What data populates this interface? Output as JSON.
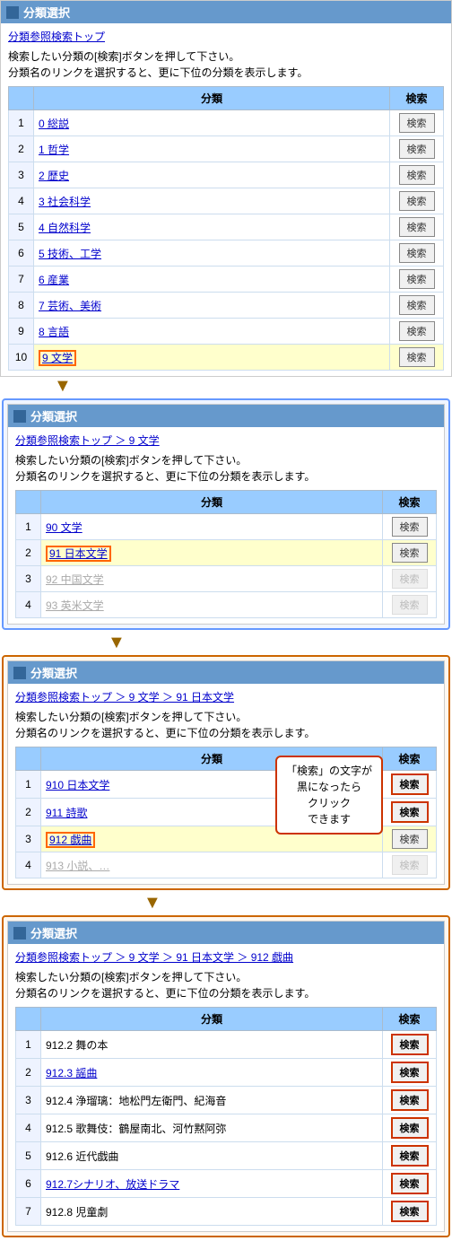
{
  "section1": {
    "title": "分類選択",
    "breadcrumb": "分類参照検索トップ",
    "desc1": "検索したい分類の[検索]ボタンを押して下さい。",
    "desc2": "分類名のリンクを選択すると、更に下位の分類を表示します。",
    "table": {
      "col1": "分類",
      "col2": "検索",
      "rows": [
        {
          "num": "1",
          "name": "0 総説",
          "link": true,
          "search": "検索",
          "highlight": false,
          "active": false
        },
        {
          "num": "2",
          "name": "1 哲学",
          "link": true,
          "search": "検索",
          "highlight": false,
          "active": false
        },
        {
          "num": "3",
          "name": "2 歴史",
          "link": true,
          "search": "検索",
          "highlight": false,
          "active": false
        },
        {
          "num": "4",
          "name": "3 社会科学",
          "link": true,
          "search": "検索",
          "highlight": false,
          "active": false
        },
        {
          "num": "5",
          "name": "4 自然科学",
          "link": true,
          "search": "検索",
          "highlight": false,
          "active": false
        },
        {
          "num": "6",
          "name": "5 技術、工学",
          "link": true,
          "search": "検索",
          "highlight": false,
          "active": false
        },
        {
          "num": "7",
          "name": "6 産業",
          "link": true,
          "search": "検索",
          "highlight": false,
          "active": false
        },
        {
          "num": "8",
          "name": "7 芸術、美術",
          "link": true,
          "search": "検索",
          "highlight": false,
          "active": false
        },
        {
          "num": "9",
          "name": "8 言語",
          "link": true,
          "search": "検索",
          "highlight": false,
          "active": false
        },
        {
          "num": "10",
          "name": "9 文学",
          "link": true,
          "search": "検索",
          "highlight": true,
          "active": false,
          "selected": true
        }
      ]
    }
  },
  "section2": {
    "title": "分類選択",
    "breadcrumb": "分類参照検索トップ ＞ 9 文学",
    "desc1": "検索したい分類の[検索]ボタンを押して下さい。",
    "desc2": "分類名のリンクを選択すると、更に下位の分類を表示します。",
    "table": {
      "col1": "分類",
      "col2": "検索",
      "rows": [
        {
          "num": "1",
          "name": "90 文学",
          "link": true,
          "search": "検索",
          "highlight": false,
          "active": false
        },
        {
          "num": "2",
          "name": "91 日本文学",
          "link": true,
          "search": "検索",
          "highlight": true,
          "active": false,
          "selected": true
        },
        {
          "num": "3",
          "name": "92 中国文学",
          "link": true,
          "search": "検索",
          "highlight": false,
          "active": false,
          "gray": true
        },
        {
          "num": "4",
          "name": "93 英米文学",
          "link": true,
          "search": "検索",
          "highlight": false,
          "active": false,
          "gray": true
        }
      ]
    }
  },
  "section3": {
    "title": "分類選択",
    "breadcrumb": "分類参照検索トップ ＞ 9 文学 ＞ 91 日本文学",
    "desc1": "検索したい分類の[検索]ボタンを押して下さい。",
    "desc2": "分類名のリンクを選択すると、更に下位の分類を表示します。",
    "tooltip": "「検索」の文字が\n黒になったら\nクリック\nできます",
    "table": {
      "col1": "分類",
      "col2": "検索",
      "rows": [
        {
          "num": "1",
          "name": "910 日本文学",
          "link": true,
          "search": "検索",
          "highlight": false,
          "active": true
        },
        {
          "num": "2",
          "name": "911 詩歌",
          "link": true,
          "search": "検索",
          "highlight": false,
          "active": true
        },
        {
          "num": "3",
          "name": "912 戯曲",
          "link": true,
          "search": "検索",
          "highlight": true,
          "active": false,
          "selected": true
        },
        {
          "num": "4",
          "name": "913 小説、…",
          "link": true,
          "search": "検索",
          "highlight": false,
          "active": false,
          "gray": true
        }
      ]
    }
  },
  "section4": {
    "title": "分類選択",
    "breadcrumb": "分類参照検索トップ ＞ 9 文学 ＞ 91 日本文学 ＞ 912 戯曲",
    "desc1": "検索したい分類の[検索]ボタンを押して下さい。",
    "desc2": "分類名のリンクを選択すると、更に下位の分類を表示します。",
    "table": {
      "col1": "分類",
      "col2": "検索",
      "rows": [
        {
          "num": "1",
          "name": "912.2 舞の本",
          "link": false,
          "search": "検索",
          "highlight": false,
          "active": true
        },
        {
          "num": "2",
          "name": "912.3 謡曲",
          "link": true,
          "search": "検索",
          "highlight": false,
          "active": true
        },
        {
          "num": "3",
          "name": "912.4 浄瑠璃：地松門左衛門、紀海音",
          "link": false,
          "search": "検索",
          "highlight": false,
          "active": true
        },
        {
          "num": "4",
          "name": "912.5 歌舞伎：鶴屋南北、河竹黙阿弥",
          "link": false,
          "search": "検索",
          "highlight": false,
          "active": true
        },
        {
          "num": "5",
          "name": "912.6 近代戯曲",
          "link": false,
          "search": "検索",
          "highlight": false,
          "active": true
        },
        {
          "num": "6",
          "name": "912.7シナリオ、放送ドラマ",
          "link": true,
          "search": "検索",
          "highlight": false,
          "active": true
        },
        {
          "num": "7",
          "name": "912.8 児童劇",
          "link": false,
          "search": "検索",
          "highlight": false,
          "active": true
        }
      ]
    }
  }
}
